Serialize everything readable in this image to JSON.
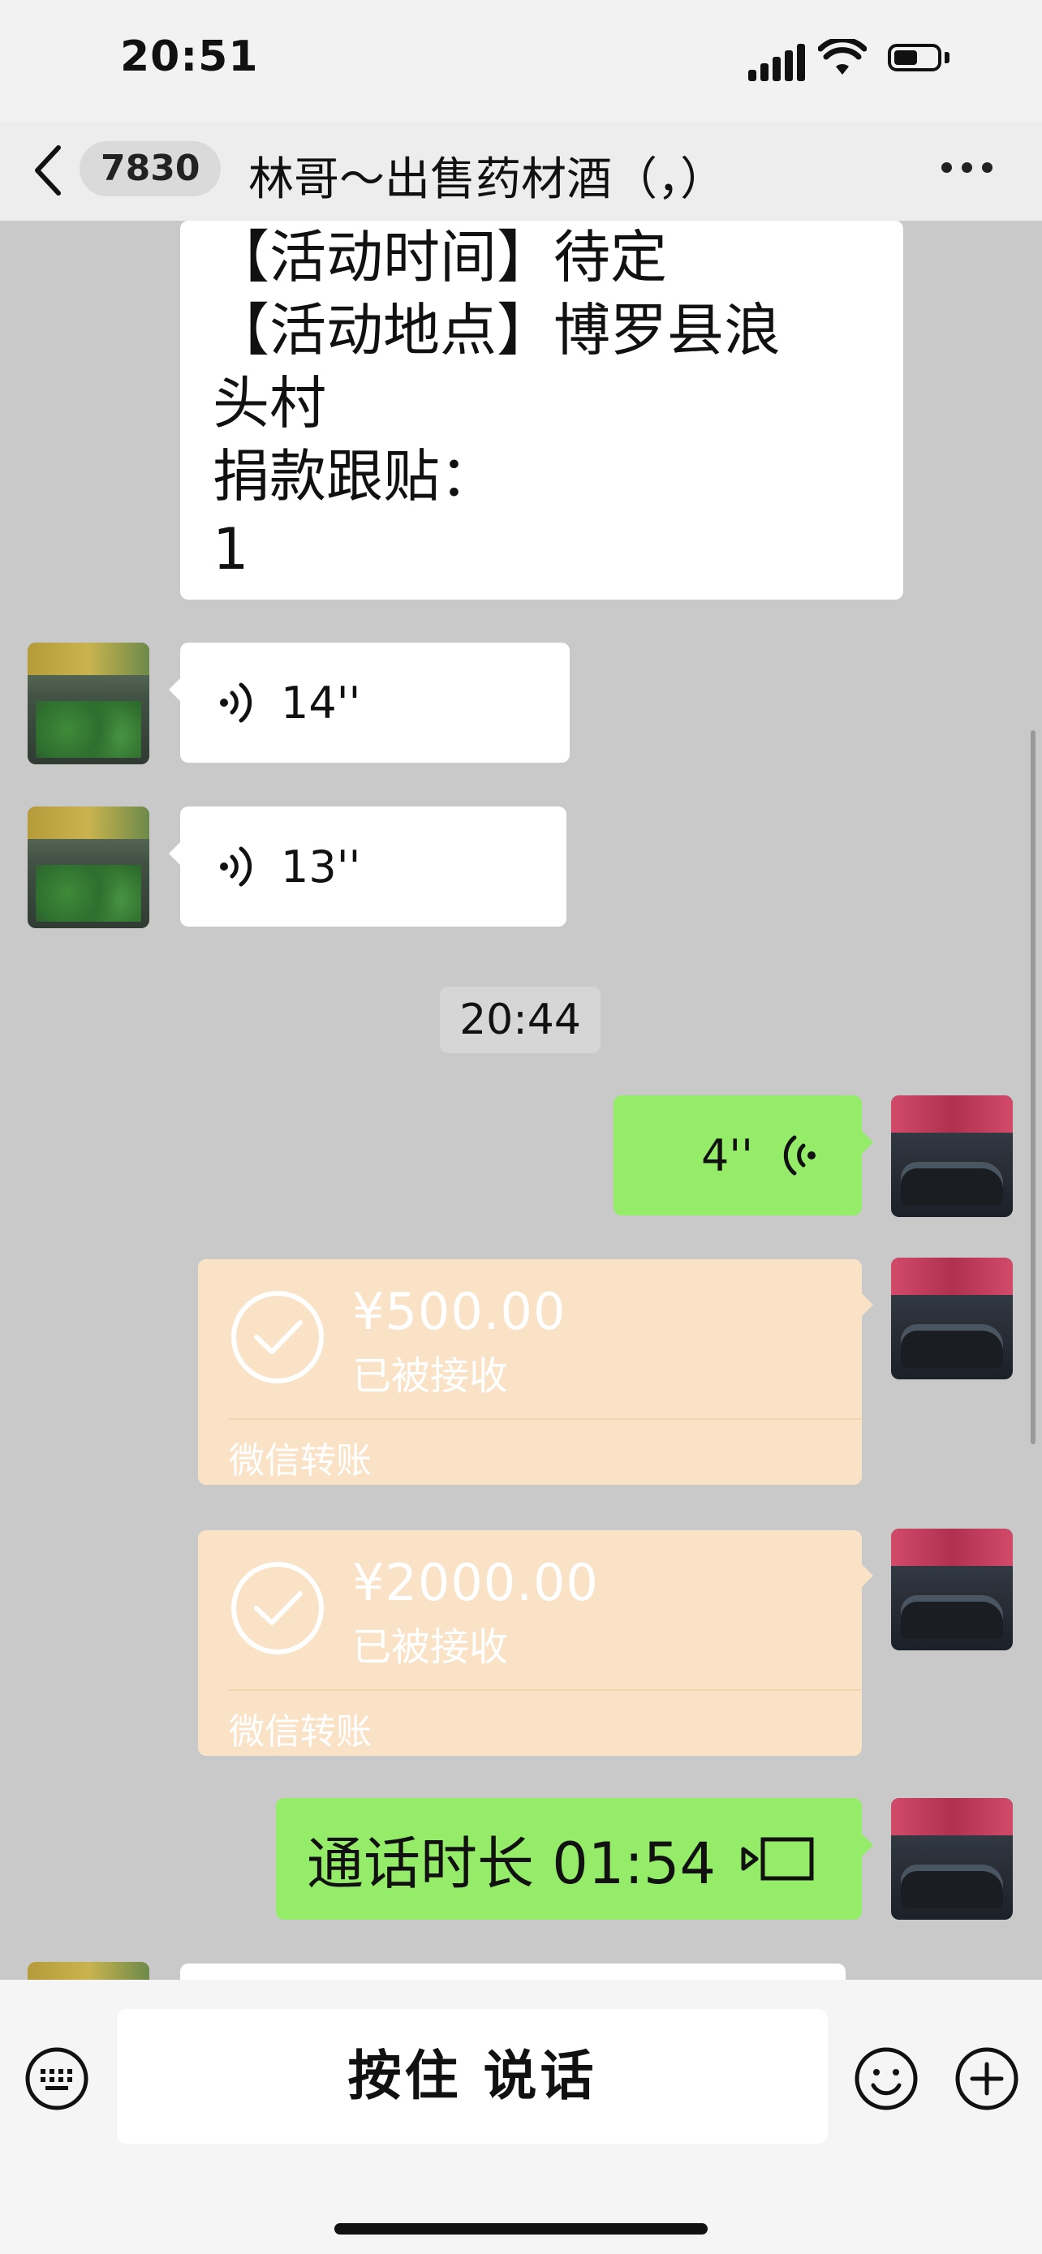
{
  "status_bar": {
    "time": "20:51"
  },
  "nav": {
    "unread_count": "7830",
    "title": "林哥～出售药材酒（，）"
  },
  "messages": {
    "text_lines": [
      "【活动时间】待定",
      "【活动地点】博罗县浪",
      "头村",
      "捐款跟贴：",
      "1"
    ],
    "voice_1": "14''",
    "voice_2": "13''",
    "timestamp": "20:44",
    "voice_out": "4''",
    "transfer_1": {
      "amount": "¥500.00",
      "status": "已被接收",
      "label": "微信转账"
    },
    "transfer_2": {
      "amount": "¥2000.00",
      "status": "已被接收",
      "label": "微信转账"
    },
    "call": "通话时长 01:54"
  },
  "input_bar": {
    "hold_to_talk": "按住 说话"
  },
  "icons": {
    "back": "chevron-left-icon",
    "more": "ellipsis-icon",
    "voice": "sound-wave-icon",
    "transfer": "check-circle-icon",
    "video": "video-call-icon",
    "keyboard": "keyboard-icon",
    "emoji": "emoji-icon",
    "plus": "plus-icon"
  },
  "colors": {
    "self_bubble": "#95ec69",
    "other_bubble": "#ffffff",
    "transfer_bubble": "#f9e2c6",
    "chat_background": "#c9c9c9"
  }
}
